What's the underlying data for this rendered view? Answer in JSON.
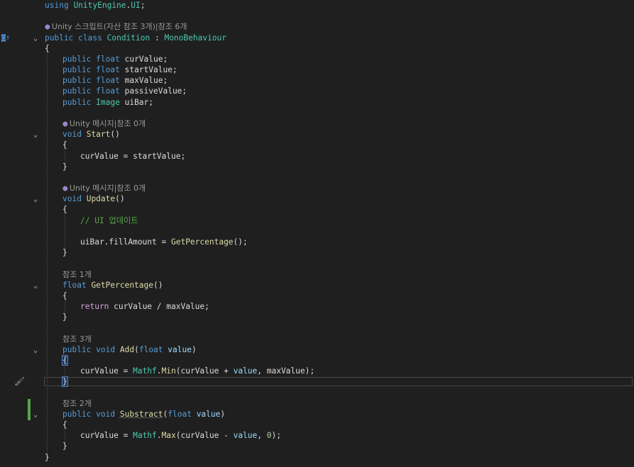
{
  "editor": {
    "lines": [
      {
        "indent": 0,
        "fold": false,
        "tokens": [
          {
            "t": "using",
            "c": "kw"
          },
          {
            "t": " "
          },
          {
            "t": "UnityEngine",
            "c": "ty"
          },
          {
            "t": "."
          },
          {
            "t": "UI",
            "c": "ty"
          },
          {
            "t": ";"
          }
        ]
      },
      {
        "indent": 0,
        "fold": false,
        "tokens": []
      },
      {
        "indent": 0,
        "fold": false,
        "lens": true,
        "cube": true,
        "tokens": [
          {
            "t": "Unity 스크립트(자산 참조 3개)|참조 6개"
          }
        ]
      },
      {
        "indent": 0,
        "fold": true,
        "marginIcon": "interface-inheritance-icon",
        "tokens": [
          {
            "t": "public",
            "c": "kw"
          },
          {
            "t": " "
          },
          {
            "t": "class",
            "c": "kw"
          },
          {
            "t": " "
          },
          {
            "t": "Condition",
            "c": "ty"
          },
          {
            "t": " : "
          },
          {
            "t": "MonoBehaviour",
            "c": "ty"
          }
        ]
      },
      {
        "indent": 0,
        "fold": false,
        "tokens": [
          {
            "t": "{"
          }
        ]
      },
      {
        "indent": 1,
        "fold": false,
        "tokens": [
          {
            "t": "public",
            "c": "kw"
          },
          {
            "t": " "
          },
          {
            "t": "float",
            "c": "kw"
          },
          {
            "t": " curValue;"
          }
        ]
      },
      {
        "indent": 1,
        "fold": false,
        "tokens": [
          {
            "t": "public",
            "c": "kw"
          },
          {
            "t": " "
          },
          {
            "t": "float",
            "c": "kw"
          },
          {
            "t": " startValue;"
          }
        ]
      },
      {
        "indent": 1,
        "fold": false,
        "tokens": [
          {
            "t": "public",
            "c": "kw"
          },
          {
            "t": " "
          },
          {
            "t": "float",
            "c": "kw"
          },
          {
            "t": " maxValue;"
          }
        ]
      },
      {
        "indent": 1,
        "fold": false,
        "tokens": [
          {
            "t": "public",
            "c": "kw"
          },
          {
            "t": " "
          },
          {
            "t": "float",
            "c": "kw"
          },
          {
            "t": " passiveValue;"
          }
        ]
      },
      {
        "indent": 1,
        "fold": false,
        "tokens": [
          {
            "t": "public",
            "c": "kw"
          },
          {
            "t": " "
          },
          {
            "t": "Image",
            "c": "ty"
          },
          {
            "t": " uiBar;"
          }
        ]
      },
      {
        "indent": 1,
        "fold": false,
        "tokens": []
      },
      {
        "indent": 1,
        "fold": false,
        "lens": true,
        "cube": true,
        "tokens": [
          {
            "t": "Unity 메시지|참조 0개"
          }
        ]
      },
      {
        "indent": 1,
        "fold": true,
        "tokens": [
          {
            "t": "void",
            "c": "kw"
          },
          {
            "t": " "
          },
          {
            "t": "Start",
            "c": "fn"
          },
          {
            "t": "()"
          }
        ]
      },
      {
        "indent": 1,
        "fold": false,
        "tokens": [
          {
            "t": "{"
          }
        ]
      },
      {
        "indent": 2,
        "fold": false,
        "tokens": [
          {
            "t": "curValue = startValue;"
          }
        ]
      },
      {
        "indent": 1,
        "fold": false,
        "tokens": [
          {
            "t": "}"
          }
        ]
      },
      {
        "indent": 1,
        "fold": false,
        "tokens": []
      },
      {
        "indent": 1,
        "fold": false,
        "lens": true,
        "cube": true,
        "tokens": [
          {
            "t": "Unity 메시지|참조 0개"
          }
        ]
      },
      {
        "indent": 1,
        "fold": true,
        "tokens": [
          {
            "t": "void",
            "c": "kw"
          },
          {
            "t": " "
          },
          {
            "t": "Update",
            "c": "fn"
          },
          {
            "t": "()"
          }
        ]
      },
      {
        "indent": 1,
        "fold": false,
        "tokens": [
          {
            "t": "{"
          }
        ]
      },
      {
        "indent": 2,
        "fold": false,
        "tokens": [
          {
            "t": "// UI 업데이트",
            "c": "cm"
          }
        ]
      },
      {
        "indent": 2,
        "fold": false,
        "tokens": []
      },
      {
        "indent": 2,
        "fold": false,
        "tokens": [
          {
            "t": "uiBar.fillAmount = "
          },
          {
            "t": "GetPercentage",
            "c": "fn"
          },
          {
            "t": "();"
          }
        ]
      },
      {
        "indent": 1,
        "fold": false,
        "tokens": [
          {
            "t": "}"
          }
        ]
      },
      {
        "indent": 1,
        "fold": false,
        "tokens": []
      },
      {
        "indent": 1,
        "fold": false,
        "lens": true,
        "tokens": [
          {
            "t": "참조 1개"
          }
        ]
      },
      {
        "indent": 1,
        "fold": true,
        "tokens": [
          {
            "t": "float",
            "c": "kw"
          },
          {
            "t": " "
          },
          {
            "t": "GetPercentage",
            "c": "fn"
          },
          {
            "t": "()"
          }
        ]
      },
      {
        "indent": 1,
        "fold": false,
        "tokens": [
          {
            "t": "{"
          }
        ]
      },
      {
        "indent": 2,
        "fold": false,
        "tokens": [
          {
            "t": "return",
            "c": "ctl"
          },
          {
            "t": " curValue / maxValue;"
          }
        ]
      },
      {
        "indent": 1,
        "fold": false,
        "tokens": [
          {
            "t": "}"
          }
        ]
      },
      {
        "indent": 1,
        "fold": false,
        "tokens": []
      },
      {
        "indent": 1,
        "fold": false,
        "lens": true,
        "tokens": [
          {
            "t": "참조 3개"
          }
        ]
      },
      {
        "indent": 1,
        "fold": true,
        "tokens": [
          {
            "t": "public",
            "c": "kw"
          },
          {
            "t": " "
          },
          {
            "t": "void",
            "c": "kw"
          },
          {
            "t": " "
          },
          {
            "t": "Add",
            "c": "fn"
          },
          {
            "t": "("
          },
          {
            "t": "float",
            "c": "kw"
          },
          {
            "t": " "
          },
          {
            "t": "value",
            "c": "par"
          },
          {
            "t": ")"
          }
        ]
      },
      {
        "indent": 1,
        "fold": false,
        "tokens": [
          {
            "t": "{",
            "c": "bracehl"
          }
        ]
      },
      {
        "indent": 2,
        "fold": false,
        "tokens": [
          {
            "t": "curValue = "
          },
          {
            "t": "Mathf",
            "c": "ty"
          },
          {
            "t": "."
          },
          {
            "t": "Min",
            "c": "fn"
          },
          {
            "t": "(curValue + "
          },
          {
            "t": "value",
            "c": "par"
          },
          {
            "t": ", maxValue);"
          }
        ]
      },
      {
        "indent": 1,
        "fold": false,
        "current": true,
        "marginIcon": "paintbrush-icon",
        "tokens": [
          {
            "t": "}",
            "c": "bracehl"
          }
        ]
      },
      {
        "indent": 1,
        "fold": false,
        "tokens": []
      },
      {
        "indent": 1,
        "fold": false,
        "lens": true,
        "tokens": [
          {
            "t": "참조 2개"
          }
        ]
      },
      {
        "indent": 1,
        "fold": true,
        "tokens": [
          {
            "t": "public",
            "c": "kw"
          },
          {
            "t": " "
          },
          {
            "t": "void",
            "c": "kw"
          },
          {
            "t": " "
          },
          {
            "t": "Substract",
            "c": "fn squiggle"
          },
          {
            "t": "("
          },
          {
            "t": "float",
            "c": "kw"
          },
          {
            "t": " "
          },
          {
            "t": "value",
            "c": "par"
          },
          {
            "t": ")"
          }
        ]
      },
      {
        "indent": 1,
        "fold": false,
        "tokens": [
          {
            "t": "{"
          }
        ]
      },
      {
        "indent": 2,
        "fold": false,
        "tokens": [
          {
            "t": "curValue = "
          },
          {
            "t": "Mathf",
            "c": "ty"
          },
          {
            "t": "."
          },
          {
            "t": "Max",
            "c": "fn"
          },
          {
            "t": "(curValue - "
          },
          {
            "t": "value",
            "c": "par"
          },
          {
            "t": ", "
          },
          {
            "t": "0",
            "c": "num"
          },
          {
            "t": ");"
          }
        ]
      },
      {
        "indent": 1,
        "fold": false,
        "tokens": [
          {
            "t": "}"
          }
        ]
      },
      {
        "indent": 0,
        "fold": false,
        "tokens": [
          {
            "t": "}"
          }
        ]
      }
    ]
  },
  "icons": {
    "fold_glyph": "⌄",
    "interface-inheritance-icon": "◙↑",
    "paintbrush-icon": "🖌",
    "unity-cube": "⬢"
  },
  "colors": {
    "background": "#1f1f1f",
    "keyword": "#569cd6",
    "type": "#4ec9b0",
    "method": "#dcdcaa",
    "comment": "#57a64a",
    "modified_bar": "#57a64a"
  }
}
